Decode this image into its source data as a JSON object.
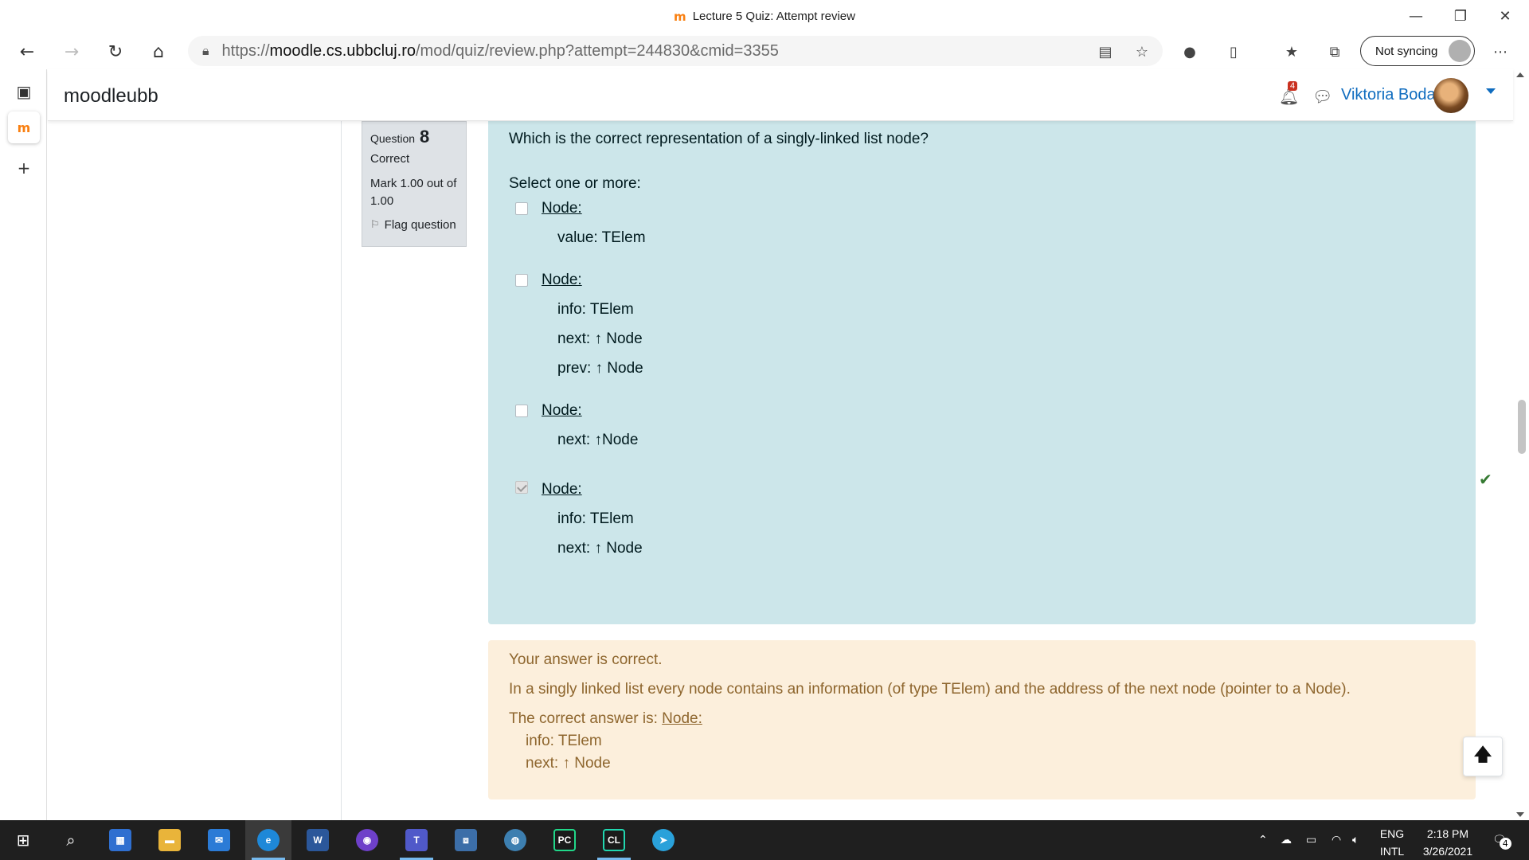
{
  "window": {
    "title": "Lecture 5 Quiz: Attempt review",
    "app_icon": "moodle-m",
    "minimize": "—",
    "restore": "❐",
    "close": "✕"
  },
  "browser": {
    "url_prefix": "https://",
    "url_host": "moodle.cs.ubbcluj.ro",
    "url_path": "/mod/quiz/review.php?attempt=244830&cmid=3355",
    "sync_label": "Not syncing"
  },
  "moodle_nav": {
    "brand": "moodleubb",
    "notifications_count": "4",
    "user_name": "Viktoria Boda"
  },
  "question_info": {
    "question_label": "Question",
    "question_number": "8",
    "state": "Correct",
    "grade": "Mark 1.00 out of 1.00",
    "flag_label": "Flag question"
  },
  "question": {
    "text": "Which is the correct representation of a singly-linked list node?",
    "prompt": "Select one or more:",
    "options": [
      {
        "head": "Node:",
        "lines": [
          "value: TElem"
        ],
        "checked": false,
        "correct": false
      },
      {
        "head": "Node:",
        "lines": [
          "info: TElem",
          "next: ↑ Node",
          "prev: ↑ Node"
        ],
        "checked": false,
        "correct": false
      },
      {
        "head": "Node:",
        "lines": [
          "next: ↑Node"
        ],
        "checked": false,
        "correct": false
      },
      {
        "head": "Node:",
        "lines": [
          "info: TElem",
          "next: ↑ Node"
        ],
        "checked": true,
        "correct": true
      }
    ]
  },
  "feedback": {
    "result": "Your answer is correct.",
    "explanation": "In a singly linked list every node contains an information (of type TElem) and the address of the next node (pointer to a Node).",
    "right_answer_prefix": "The correct answer is: ",
    "right_answer_head": "Node:",
    "right_answer_lines": [
      "info: TElem",
      "next: ↑ Node"
    ]
  },
  "taskbar": {
    "lang_top": "ENG",
    "lang_bottom": "INTL",
    "time": "2:18 PM",
    "date": "3/26/2021",
    "notification_count": "4"
  },
  "colors": {
    "formulation_bg": "#cce6ea",
    "outcome_bg": "#fcefdc",
    "link_blue": "#0f6cbf",
    "correct_green": "#357a32"
  }
}
